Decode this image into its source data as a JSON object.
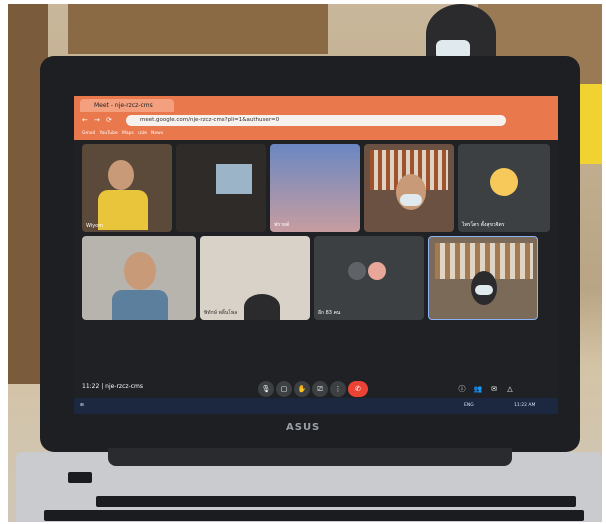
{
  "browser": {
    "tab_title": "Meet - nje-rzcz-cms",
    "address": "meet.google.com/nje-rzcz-cms?pli=1&authuser=0",
    "bookmarks": [
      "Gmail",
      "YouTube",
      "Maps",
      "แปล",
      "News"
    ]
  },
  "meeting": {
    "time": "11:22",
    "code": "nje-rzcz-cms",
    "participants": [
      {
        "name": "Wiyom"
      },
      {
        "name": ""
      },
      {
        "name": "ฟรายด์"
      },
      {
        "name": ""
      },
      {
        "name": "ไพรโตร ตั้งสุขวจิตร"
      },
      {
        "name": ""
      },
      {
        "name": "พิทักษ์ พลิ้นโพล"
      },
      {
        "name": "อีก 83 คน"
      },
      {
        "name": ""
      }
    ]
  },
  "taskbar": {
    "lang": "ENG",
    "clock": "11:22 AM"
  },
  "laptop": {
    "logo": "ASUS"
  },
  "icons": [
    "back-icon",
    "forward-icon",
    "reload-icon",
    "mic-icon",
    "camera-icon",
    "hand-icon",
    "present-icon",
    "more-icon",
    "end-call-icon",
    "info-icon",
    "people-icon",
    "chat-icon",
    "activities-icon"
  ]
}
